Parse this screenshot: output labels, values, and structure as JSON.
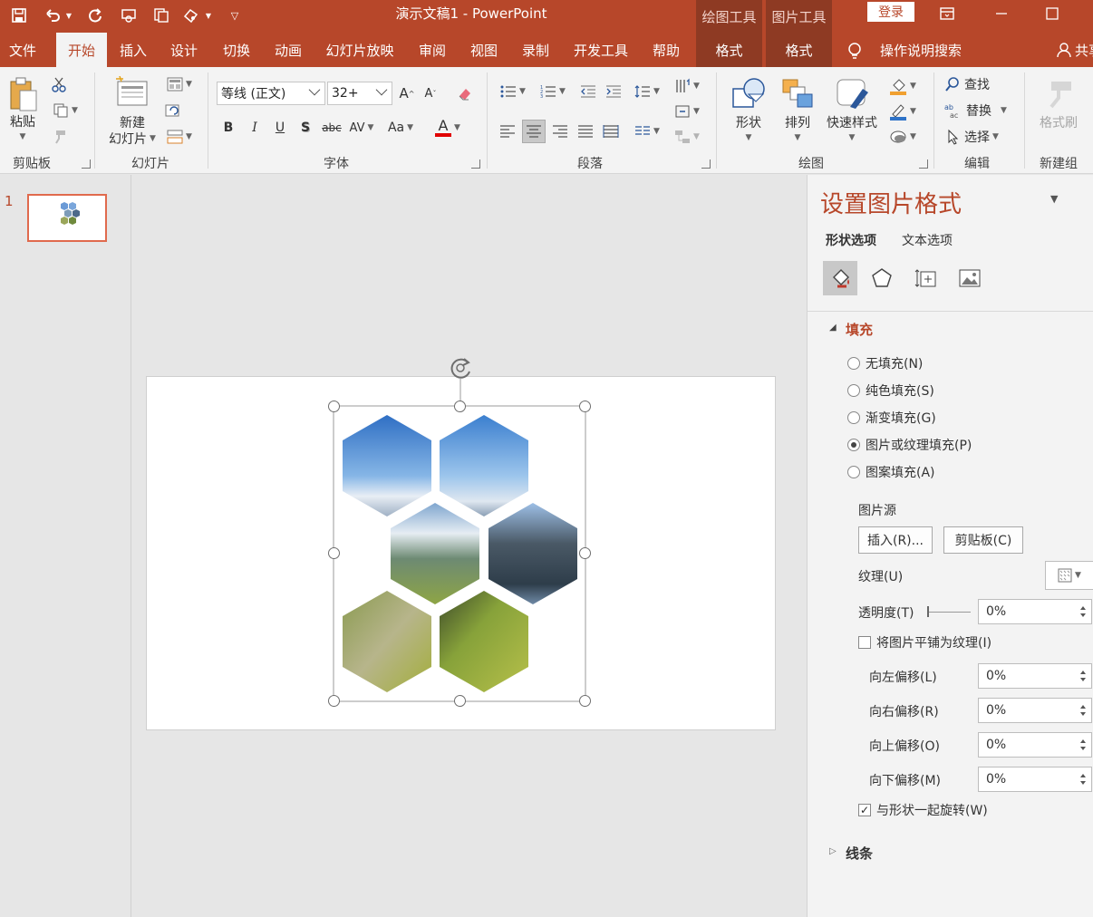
{
  "app": {
    "title": "演示文稿1  -  PowerPoint",
    "login": "登录",
    "context_groups": {
      "drawing_tools": "绘图工具",
      "picture_tools": "图片工具"
    }
  },
  "tabs": [
    {
      "label": "文件"
    },
    {
      "label": "开始"
    },
    {
      "label": "插入"
    },
    {
      "label": "设计"
    },
    {
      "label": "切换"
    },
    {
      "label": "动画"
    },
    {
      "label": "幻灯片放映"
    },
    {
      "label": "审阅"
    },
    {
      "label": "视图"
    },
    {
      "label": "录制"
    },
    {
      "label": "开发工具"
    },
    {
      "label": "帮助"
    },
    {
      "label": "格式"
    },
    {
      "label": "格式"
    }
  ],
  "tell_me": "操作说明搜索",
  "share": "共享",
  "ribbon": {
    "clipboard": {
      "paste": "粘贴",
      "label": "剪贴板"
    },
    "slides": {
      "new_slide_line1": "新建",
      "new_slide_line2": "幻灯片",
      "label": "幻灯片"
    },
    "font": {
      "font_name": "等线 (正文)",
      "font_size": "32+",
      "label": "字体",
      "bold": "B",
      "italic": "I",
      "underline": "U",
      "shadow": "S",
      "strike": "abc",
      "spacing": "AV",
      "case": "Aa",
      "color": "A"
    },
    "paragraph": {
      "label": "段落"
    },
    "drawing": {
      "shapes": "形状",
      "arrange": "排列",
      "quick_styles": "快速样式",
      "label": "绘图"
    },
    "editing": {
      "find": "查找",
      "replace": "替换",
      "select": "选择",
      "label": "编辑"
    },
    "new_group": {
      "format_painter": "格式刷",
      "label": "新建组"
    }
  },
  "thumbnails": [
    {
      "number": "1"
    }
  ],
  "format_pane": {
    "title": "设置图片格式",
    "tabs": {
      "shape_options": "形状选项",
      "text_options": "文本选项"
    },
    "fill_section": "填充",
    "fill_options": [
      {
        "label": "无填充(N)",
        "selected": false
      },
      {
        "label": "纯色填充(S)",
        "selected": false
      },
      {
        "label": "渐变填充(G)",
        "selected": false
      },
      {
        "label": "图片或纹理填充(P)",
        "selected": true
      },
      {
        "label": "图案填充(A)",
        "selected": false
      }
    ],
    "picture_source": "图片源",
    "insert_btn": "插入(R)...",
    "clipboard_btn": "剪贴板(C)",
    "texture": "纹理(U)",
    "transparency": {
      "label": "透明度(T)",
      "value": "0%"
    },
    "tile_as_texture": {
      "label": "将图片平铺为纹理(I)",
      "checked": false
    },
    "offsets": [
      {
        "label": "向左偏移(L)",
        "value": "0%"
      },
      {
        "label": "向右偏移(R)",
        "value": "0%"
      },
      {
        "label": "向上偏移(O)",
        "value": "0%"
      },
      {
        "label": "向下偏移(M)",
        "value": "0%"
      }
    ],
    "rotate_with_shape": {
      "label": "与形状一起旋转(W)",
      "checked": true
    },
    "line_section": "线条"
  },
  "colors": {
    "accent": "#b7472a",
    "context_tab": "#8e3a23"
  }
}
